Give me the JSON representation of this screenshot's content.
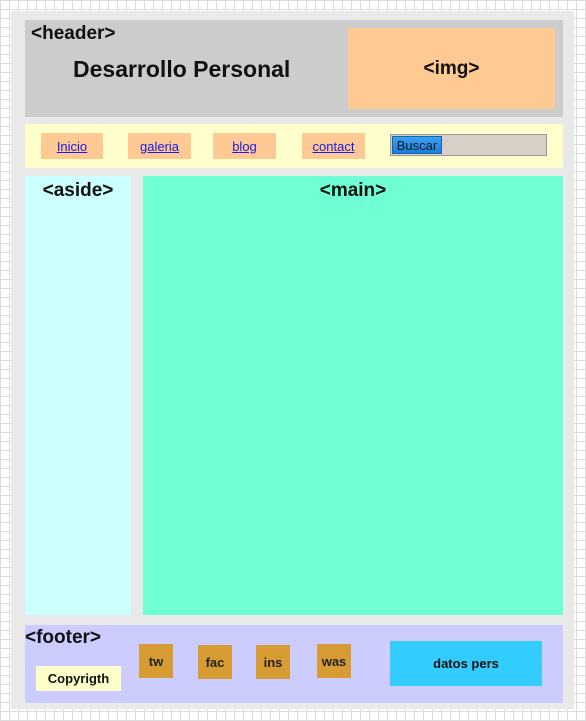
{
  "header": {
    "tag": "<header>",
    "title": "Desarrollo Personal",
    "img_label": "<img>"
  },
  "nav": {
    "items": [
      {
        "label": "Inicio"
      },
      {
        "label": "galeria"
      },
      {
        "label": "blog"
      },
      {
        "label": "contact"
      }
    ],
    "search_button": "Buscar"
  },
  "aside": {
    "tag": "<aside>"
  },
  "main": {
    "tag": "<main>"
  },
  "footer": {
    "tag": "<footer>",
    "copyright": "Copyrigth",
    "social": [
      {
        "label": "tw"
      },
      {
        "label": "fac"
      },
      {
        "label": "ins"
      },
      {
        "label": "was"
      }
    ],
    "datos": "datos pers"
  },
  "colors": {
    "header_bg": "#cccccc",
    "img_bg": "#ffc993",
    "nav_bg": "#ffffcc",
    "aside_bg": "#ccffff",
    "main_bg": "#70ffd4",
    "footer_bg": "#ccccff",
    "social_bg": "#d69b33",
    "datos_bg": "#33ccff"
  }
}
